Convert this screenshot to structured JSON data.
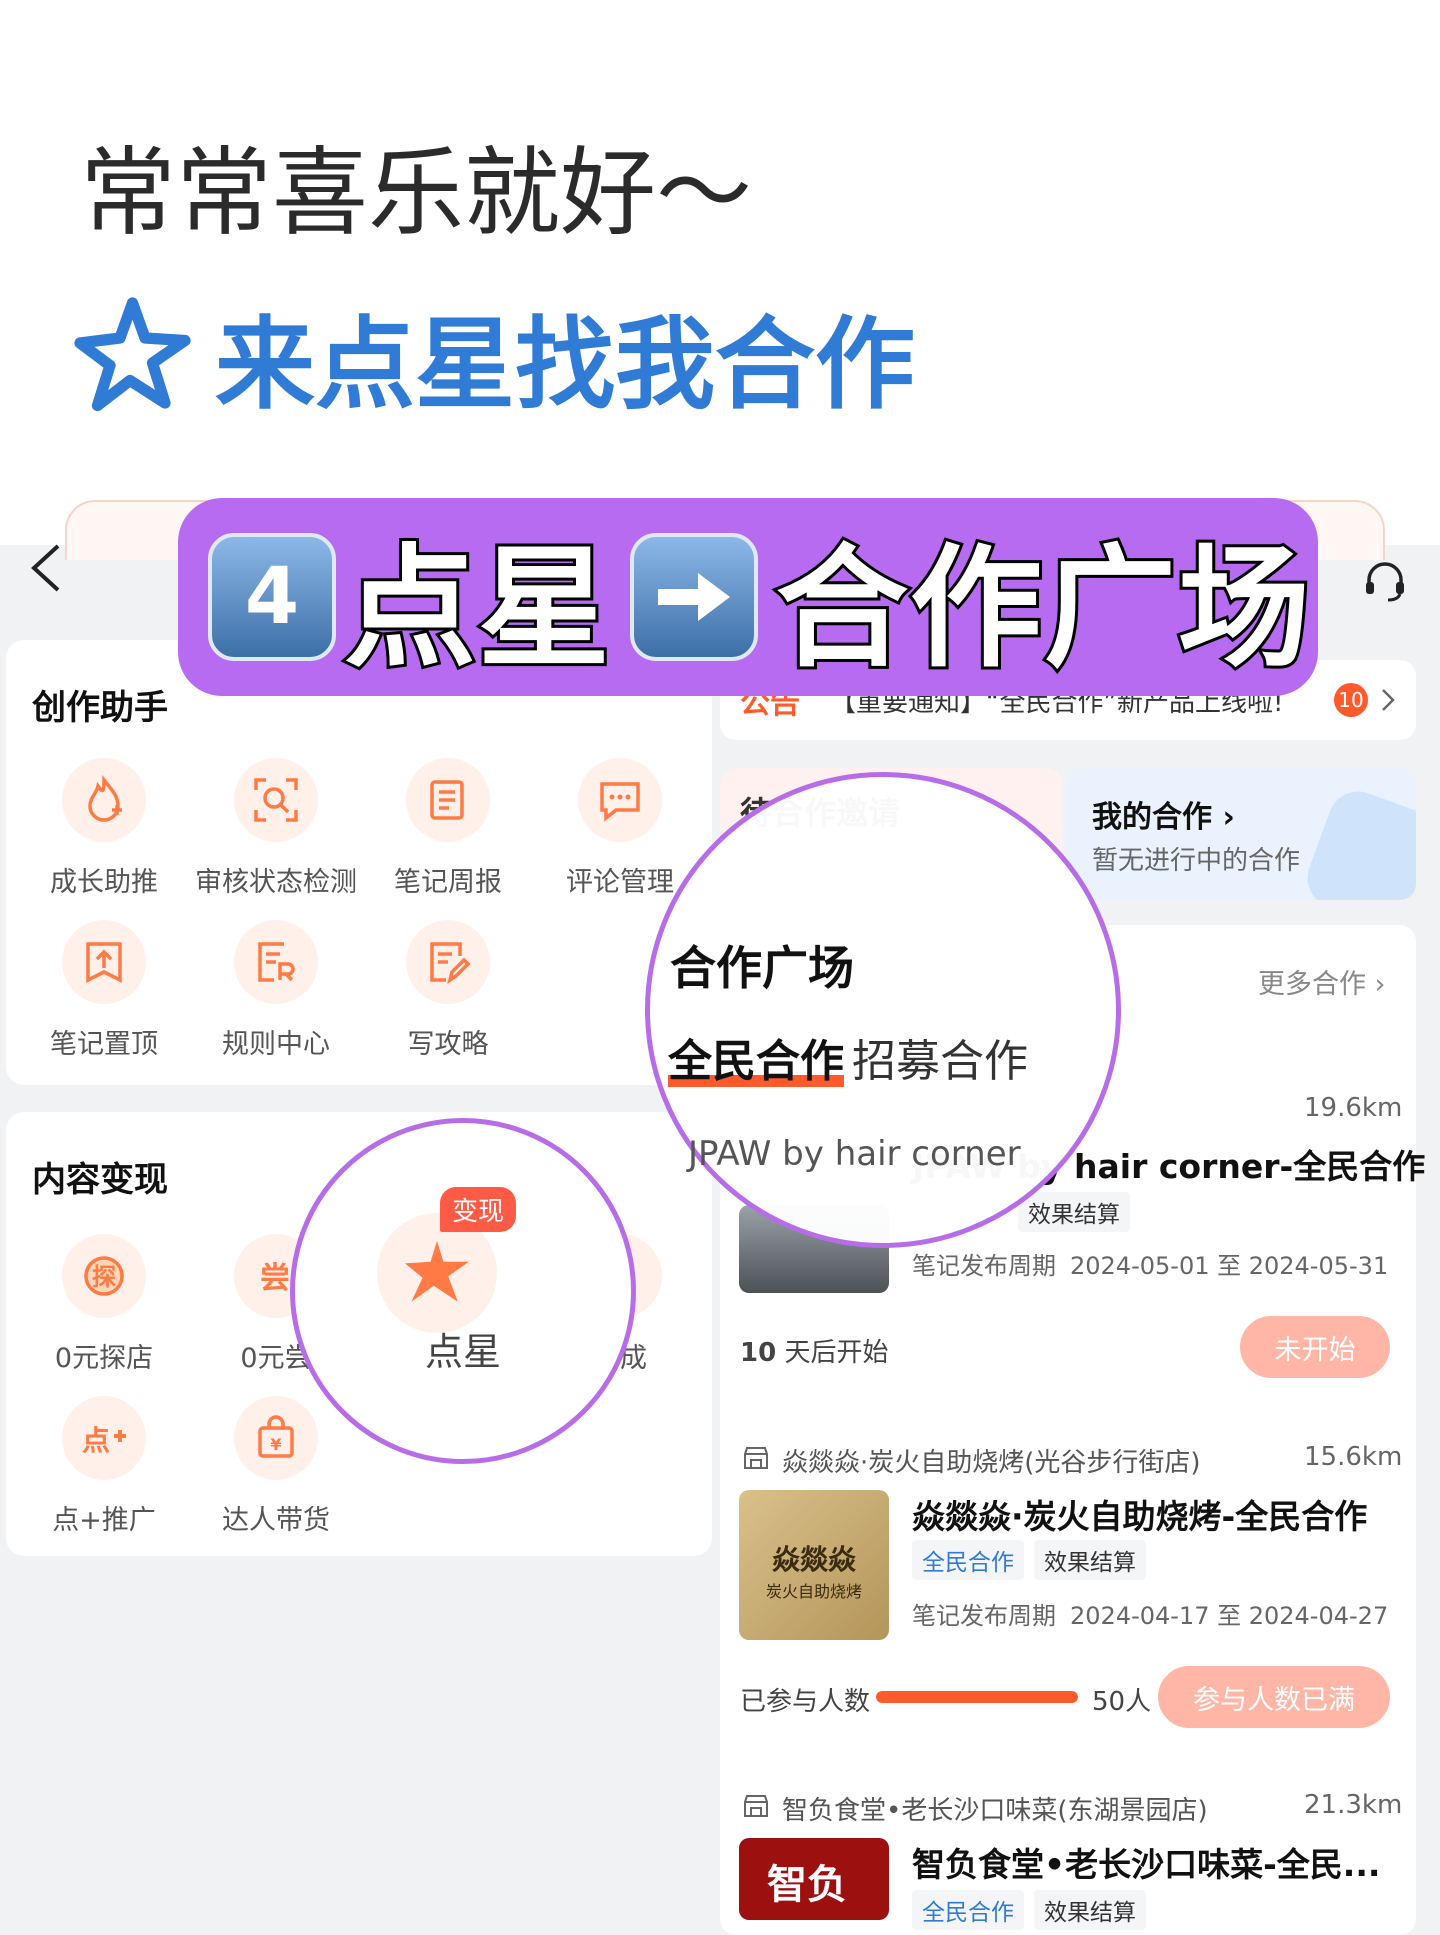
{
  "top": {
    "bio": "常常喜乐就好～",
    "dx_link": "来点星找我合作"
  },
  "banner": {
    "num": "4",
    "part1": "点星",
    "part2": "合作广场"
  },
  "creation": {
    "title": "创作助手",
    "tools": [
      {
        "label": "成长助推",
        "icon": "flame-plus-icon"
      },
      {
        "label": "审核状态检测",
        "icon": "scan-search-icon"
      },
      {
        "label": "笔记周报",
        "icon": "report-icon"
      },
      {
        "label": "评论管理",
        "icon": "comment-icon"
      },
      {
        "label": "笔记置顶",
        "icon": "pin-top-icon"
      },
      {
        "label": "规则中心",
        "icon": "rules-icon"
      },
      {
        "label": "写攻略",
        "icon": "edit-guide-icon"
      }
    ]
  },
  "monetize": {
    "title": "内容变现",
    "tools": [
      {
        "label": "0元探店",
        "icon": "explore-store-icon"
      },
      {
        "label": "0元尝",
        "icon": "taste-icon"
      },
      {
        "label": "分成",
        "icon": "share-icon"
      },
      {
        "label": "点+推广",
        "icon": "dian-plus-icon"
      },
      {
        "label": "达人带货",
        "icon": "shopping-bag-icon"
      }
    ],
    "lens_label": "点星",
    "lens_badge": "变现"
  },
  "notice": {
    "tag": "公告",
    "text": "【重要通知】“全民合作”新产品上线啦!",
    "count": "10"
  },
  "cards": {
    "invite": "待合作邀请",
    "mine_title": "我的合作",
    "mine_sub": "暂无进行中的合作"
  },
  "square": {
    "title": "合作广场",
    "tab_active": "全民合作",
    "tab_other": "招募合作",
    "more": "更多合作"
  },
  "shops": [
    {
      "name": "JPAW by hair corner",
      "dist": "19.6km",
      "title": "JPAW by hair corner-全民合作",
      "tags": [
        "效果结算"
      ],
      "period_label": "笔记发布周期",
      "period": "2024-05-01 至 2024-05-31",
      "foot_num": "10",
      "foot_text": "天后开始",
      "status": "未开始"
    },
    {
      "name": "焱燚焱·炭火自助烧烤(光谷步行街店)",
      "dist": "15.6km",
      "title": "焱燚焱·炭火自助烧烤-全民合作",
      "tags": [
        "全民合作",
        "效果结算"
      ],
      "period_label": "笔记发布周期",
      "period": "2024-04-17 至 2024-04-27",
      "joined_label": "已参与人数",
      "joined_count": "50人",
      "progress": 1.0,
      "status": "参与人数已满",
      "thumb_text": "焱燚焱",
      "thumb_sub": "炭火自助烧烤"
    },
    {
      "name": "智负食堂•老长沙口味菜(东湖景园店)",
      "dist": "21.3km",
      "title": "智负食堂•老长沙口味菜-全民...",
      "tags": [
        "全民合作",
        "效果结算"
      ],
      "thumb_text": "智负"
    }
  ],
  "colors": {
    "accent": "#ff5a2c",
    "dx_blue": "#2f7bd6",
    "banner_purple": "#b66bf0"
  }
}
